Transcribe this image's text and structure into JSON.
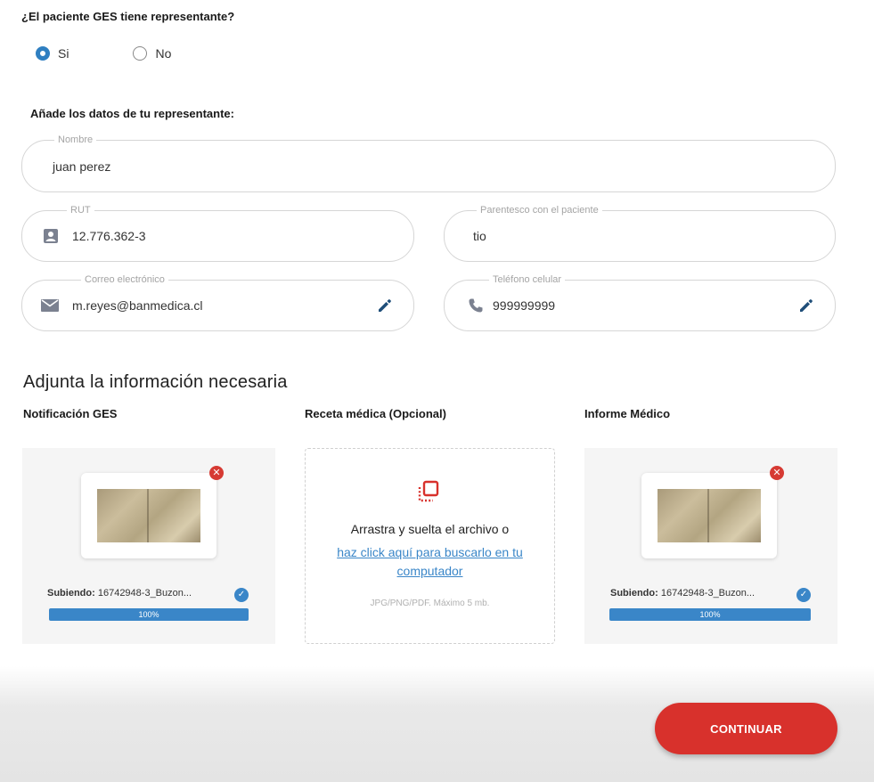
{
  "question": {
    "title": "¿El paciente GES tiene representante?",
    "options": [
      {
        "label": "Si",
        "checked": true
      },
      {
        "label": "No",
        "checked": false
      }
    ]
  },
  "representative": {
    "title": "Añade los datos de tu representante:",
    "name": {
      "legend": "Nombre",
      "value": "juan perez"
    },
    "rut": {
      "legend": "RUT",
      "value": "12.776.362-3",
      "icon": "id-badge-icon"
    },
    "relationship": {
      "legend": "Parentesco con el paciente",
      "value": "tio"
    },
    "email": {
      "legend": "Correo electrónico",
      "value": "m.reyes@banmedica.cl",
      "icon": "mail-icon",
      "action_icon": "pencil-icon"
    },
    "phone": {
      "legend": "Teléfono celular",
      "value": "999999999",
      "icon": "phone-icon",
      "action_icon": "pencil-icon"
    }
  },
  "attachments": {
    "title": "Adjunta la información necesaria",
    "columns": [
      {
        "title": "Notificación GES",
        "state": "uploading",
        "uploading_prefix": "Subiendo:",
        "file_name": "16742948-3_Buzon...",
        "progress_label": "100%",
        "progress": 1.0
      },
      {
        "title": "Receta médica (Opcional)",
        "state": "empty",
        "drop_text": "Arrastra y suelta el archivo o",
        "drop_link": "haz click aquí para buscarlo en tu computador",
        "hint": "JPG/PNG/PDF. Máximo 5 mb."
      },
      {
        "title": "Informe Médico",
        "state": "uploading",
        "uploading_prefix": "Subiendo:",
        "file_name": "16742948-3_Buzon...",
        "progress_label": "100%",
        "progress": 1.0
      }
    ]
  },
  "footer": {
    "continue_label": "CONTINUAR"
  },
  "colors": {
    "accent_blue": "#3a86c8",
    "primary_red": "#d8312c",
    "remove_red": "#d63a33"
  }
}
